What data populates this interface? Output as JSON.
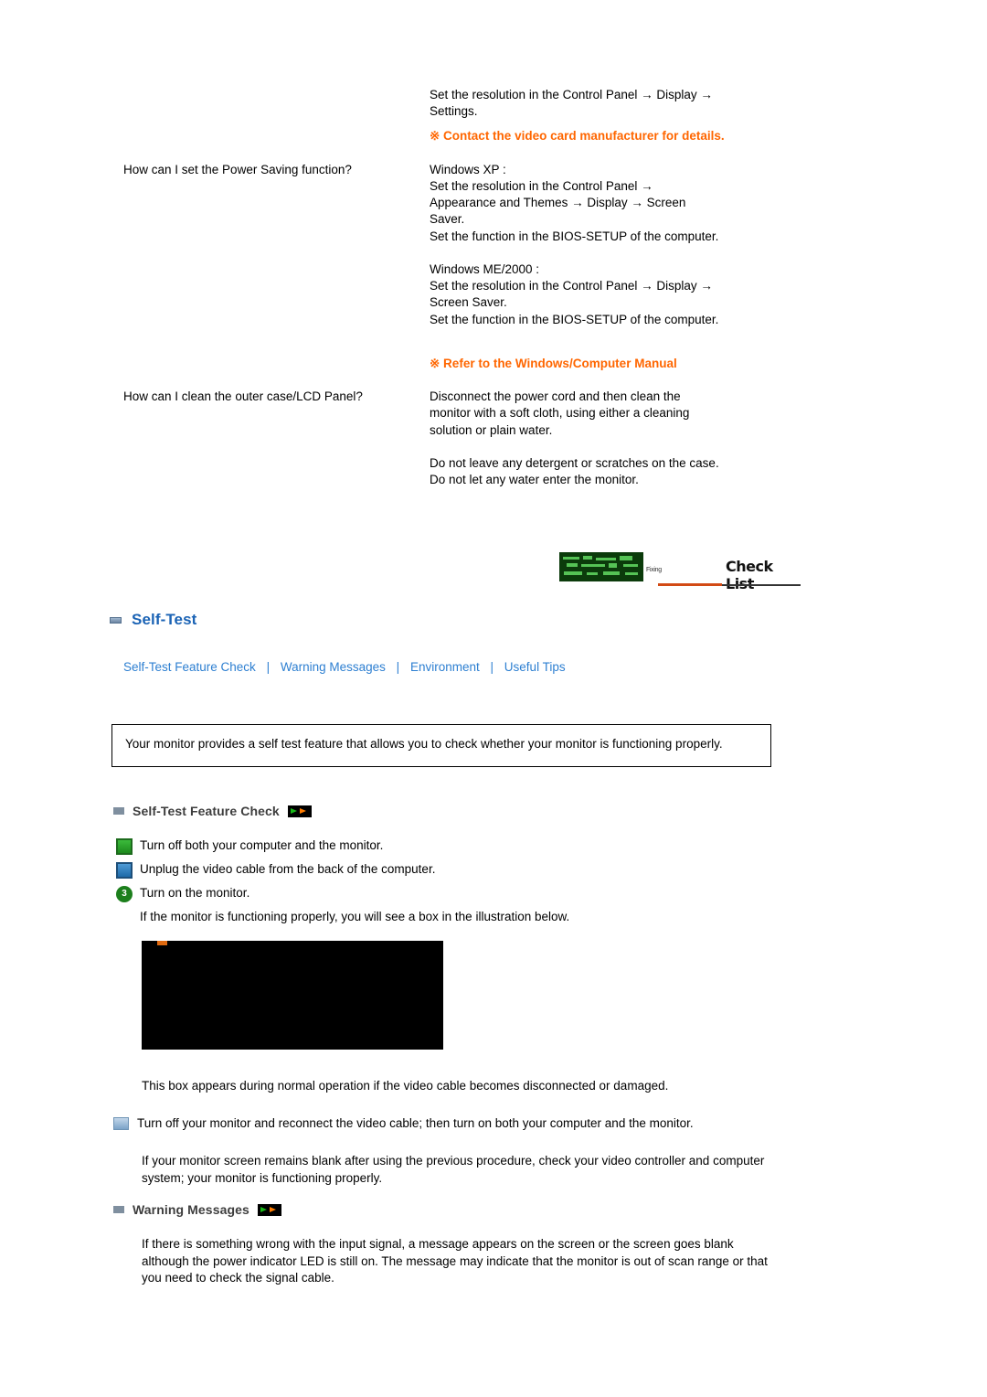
{
  "faq": [
    {
      "question": "",
      "answer_lines": [
        "Set the resolution in the Control Panel → Display →",
        "Settings."
      ],
      "note": "※  Contact the video card manufacturer for details."
    },
    {
      "question": "How can I set the Power Saving function?",
      "answer_lines": [
        "Windows XP :",
        "Set the resolution in the Control Panel →",
        "Appearance and Themes → Display → Screen",
        "Saver.",
        "Set the function in the BIOS-SETUP of the computer.",
        "",
        "Windows ME/2000 :",
        "Set the resolution in the Control Panel → Display →",
        "Screen Saver.",
        "Set the function in the BIOS-SETUP of the computer."
      ],
      "note": "※  Refer to the Windows/Computer Manual"
    },
    {
      "question": "How can I clean the outer case/LCD Panel?",
      "answer_lines": [
        "Disconnect the power cord and then clean the",
        "monitor with a soft cloth, using either a cleaning",
        "solution or plain water.",
        "",
        "Do not leave any detergent or scratches on the case.",
        "Do not let any water enter the monitor."
      ],
      "note": ""
    }
  ],
  "checklist_graphic": {
    "caption": "Check List",
    "chip_label": "Fixing"
  },
  "section": {
    "title": "Self-Test",
    "icon": "blue-box-icon"
  },
  "subnav": {
    "items": [
      "Self-Test Feature Check",
      "Warning Messages",
      "Environment",
      "Useful Tips"
    ],
    "separator": "|"
  },
  "intro_box": {
    "text": "Your monitor provides a self test feature that allows you to check whether your monitor is functioning properly."
  },
  "self_test": {
    "heading": "Self-Test Feature Check",
    "steps": [
      {
        "num": "1",
        "text": "Turn off both your computer and the monitor."
      },
      {
        "num": "2",
        "text": "Unplug the video cable from the back of the computer."
      },
      {
        "num": "3",
        "text": "Turn on the monitor."
      }
    ],
    "after_steps": "If the monitor is functioning properly, you will see a box in the illustration below.",
    "caption_below_image": "This box appears during normal operation if the video cable becomes disconnected or damaged.",
    "reconnect_text": "Turn off your monitor and reconnect the video cable; then turn on both your computer and the monitor.",
    "closing_text": "If your monitor screen remains blank after using the previous procedure, check your video controller and computer system; your monitor is functioning properly."
  },
  "warning": {
    "heading": "Warning Messages",
    "text": "If there is something wrong with the input signal, a message appears on the screen or the screen goes blank although the power indicator LED is still on. The message may indicate that the monitor is out of scan range or that you need to check the signal cable."
  },
  "colors": {
    "link": "#2d7fd1",
    "section_title": "#1b63b5",
    "note": "#ff6600",
    "heading_gray": "#3d3d3d"
  }
}
